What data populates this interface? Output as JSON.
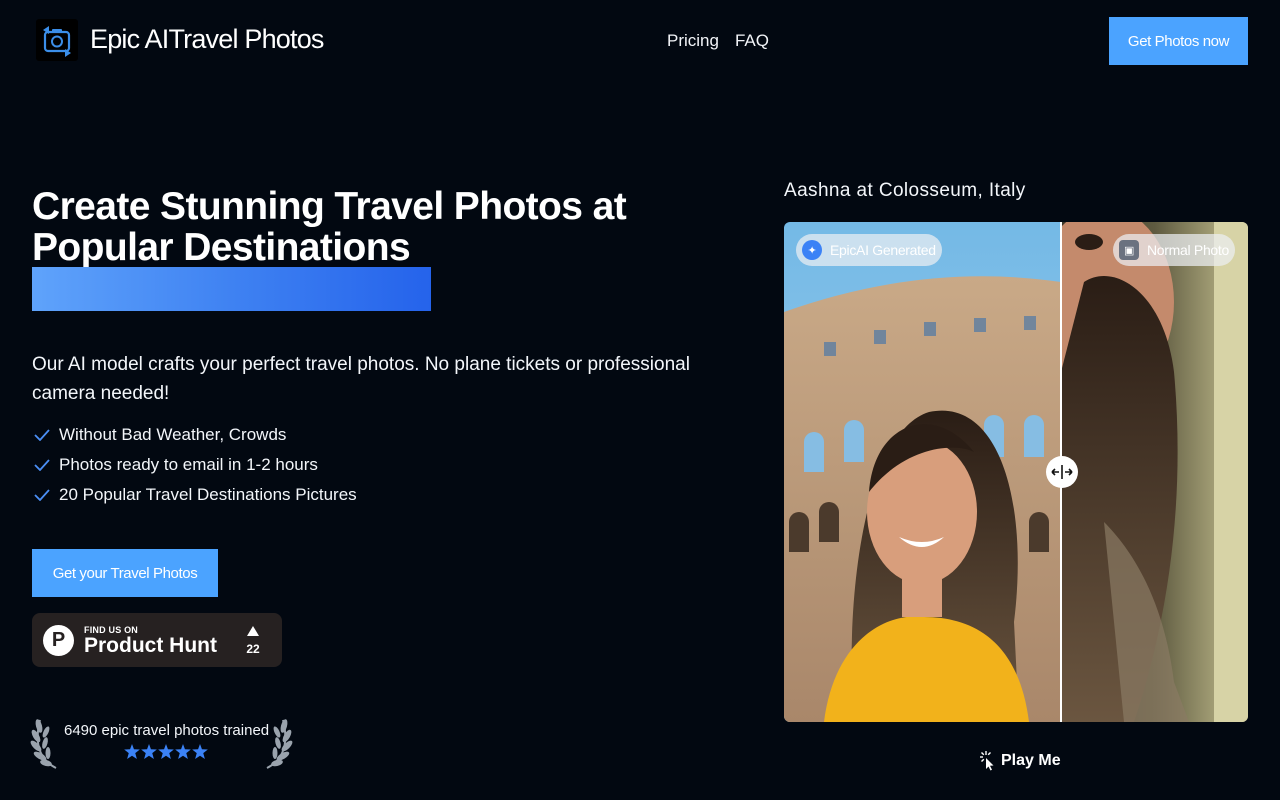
{
  "header": {
    "brand": "Epic AITravel Photos",
    "nav": [
      {
        "label": "Pricing"
      },
      {
        "label": "FAQ"
      }
    ],
    "cta": "Get Photos now"
  },
  "hero": {
    "title": "Create Stunning Travel Photos at Popular Destinations",
    "lead": "Our AI model crafts your perfect travel photos. No plane tickets or professional camera needed!",
    "features": [
      "Without Bad Weather, Crowds",
      "Photos ready to email in 1-2 hours",
      "20 Popular Travel Destinations Pictures"
    ],
    "cta": "Get your Travel Photos"
  },
  "product_hunt": {
    "find_us": "FIND US ON",
    "name": "Product Hunt",
    "count": "22"
  },
  "social_proof": {
    "text": "6490 epic travel photos trained",
    "rating_stars": 5
  },
  "comparison": {
    "caption": "Aashna at Colosseum, Italy",
    "left_tag": "EpicAI Generated",
    "right_tag": "Normal Photo",
    "split_fraction": 0.6
  },
  "play": {
    "label": "Play Me"
  },
  "colors": {
    "background": "#020811",
    "accent": "#4ba3ff",
    "gradient_start": "#5fa3fb",
    "gradient_end": "#2563eb",
    "star": "#3b82f6"
  }
}
